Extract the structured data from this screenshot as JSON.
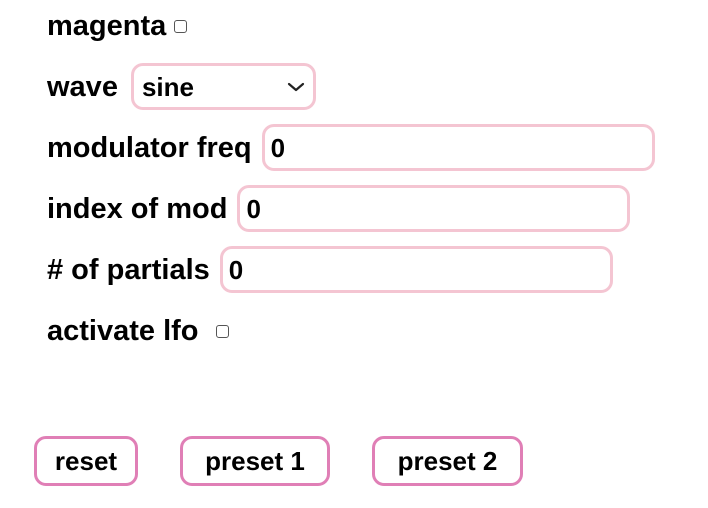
{
  "controls": {
    "magenta": {
      "label": "magenta",
      "checked": false
    },
    "wave": {
      "label": "wave",
      "selected": "sine"
    },
    "modulator_freq": {
      "label": "modulator freq",
      "value": "0"
    },
    "index_of_mod": {
      "label": "index of mod",
      "value": "0"
    },
    "partials": {
      "label": "# of partials",
      "value": "0"
    },
    "activate_lfo": {
      "label": "activate lfo",
      "checked": false
    }
  },
  "buttons": {
    "reset": "reset",
    "preset1": "preset 1",
    "preset2": "preset 2"
  },
  "colors": {
    "field_border": "#f4c5d2",
    "button_border": "#e07fb6"
  },
  "icons": {
    "dropdown": "chevron-down-icon"
  }
}
